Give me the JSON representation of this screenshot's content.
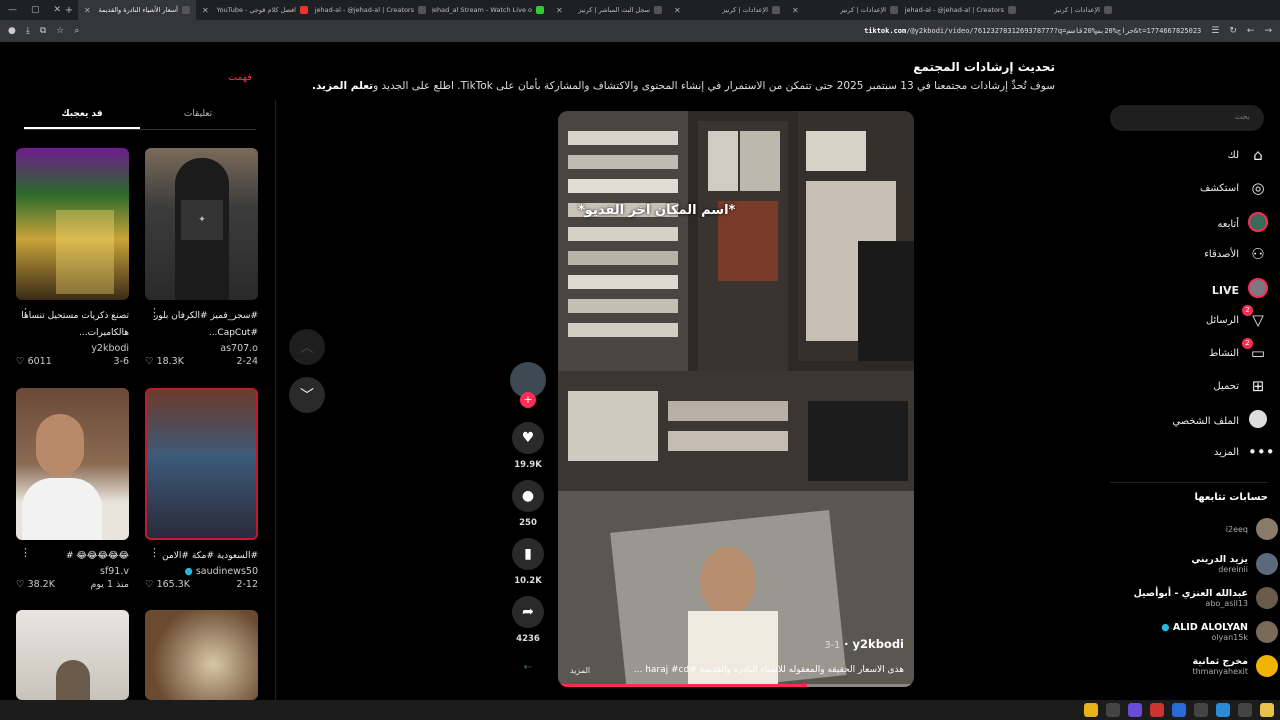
{
  "browser": {
    "tabs": [
      {
        "title": "أسعار الأشياء النادرة والقديمة",
        "active": true
      },
      {
        "title": "YouTube - افضل كلام قوجي"
      },
      {
        "title": "jehad-al - @jehad-al | Creators"
      },
      {
        "title": "Jehad_al Stream - Watch Live o"
      },
      {
        "title": "سجل البث المباشر | كرنيز"
      },
      {
        "title": "الإعدادات | كرنيز"
      },
      {
        "title": "الإعدادات | كرنيز"
      },
      {
        "title": "jehad-al - @jehad-al | Creators"
      },
      {
        "title": "الإعدادات | كرنيز"
      }
    ],
    "url_host": "tiktok.com",
    "url_path": "/@y2kbodi/video/7612327831269378777?q=حراج%20بس%20قاسم&t=1774667825023"
  },
  "banner": {
    "title": "تحديث إرشادات المجتمع",
    "text": "سوف تُحدِّ إرشادات مجتمعنا في 13 سبتمبر 2025 حتى تتمكن من الاستمرار في إنشاء المحتوى والاكتشاف والمشاركة بأمان على TikTok. اطلع على الجديد و",
    "link": "تعلم المزيد.",
    "dismiss": "فهمت"
  },
  "left_panel": {
    "tabs": [
      "تعليقات",
      "قد يعجبك"
    ],
    "active_tab": "قد يعجبك",
    "cards": [
      {
        "title": "#سجر_قميز #الكرفان بلور #CapCut...",
        "user": "as707.o",
        "likes": "18.3K",
        "date": "2-24"
      },
      {
        "title": "تصنع ذكريات مستحيل تنساها هالكاميرات...",
        "user": "y2kbodi",
        "likes": "6011",
        "date": "3-6"
      },
      {
        "title": "#السعودية #مكة #الامن",
        "user": "saudinews50",
        "likes": "165.3K",
        "date": "2-12"
      },
      {
        "title": "😂😂😂😂😂 #",
        "user": "sf91.v",
        "likes": "38.2K",
        "date": "منذ 1 يوم"
      },
      {
        "title": "",
        "user": "",
        "likes": "",
        "date": ""
      },
      {
        "title": "",
        "user": "",
        "likes": "",
        "date": ""
      }
    ]
  },
  "video": {
    "caption": "*اسم المكان اخر الفديو*",
    "username": "y2kbodi",
    "date": "3-1",
    "description": "هذى الاسعار الحقيقه والمعقوله للاشياء النادره والقديمة #haraj #cd ...",
    "more": "المزيد",
    "progress": 0.7
  },
  "actions": {
    "likes": "19.9K",
    "comments": "250",
    "saves": "10.2K",
    "shares": "4236"
  },
  "sidebar": {
    "search_placeholder": "بحث",
    "nav": [
      "لك",
      "استكشف",
      "أتابعه",
      "الأصدقاء",
      "LIVE",
      "الرسائل",
      "النشاط",
      "تحميل",
      "الملف الشخصي",
      "المزيد"
    ],
    "messages_badge": "2",
    "activity_badge": "2",
    "following_title": "حسابات تتابعها",
    "following": [
      {
        "name": "",
        "user": "i2eeq"
      },
      {
        "name": "يزيد الدريني",
        "user": "dereinii"
      },
      {
        "name": "عبدالله العنزي - أبوأصيل",
        "user": "abo_asil13"
      },
      {
        "name": "ALID ALOLYAN",
        "user": "olyan15k"
      },
      {
        "name": "مخرج ثمانية",
        "user": "thmanyahexit"
      }
    ]
  },
  "colors": {
    "accent": "#fe2c55",
    "background": "#000000"
  }
}
